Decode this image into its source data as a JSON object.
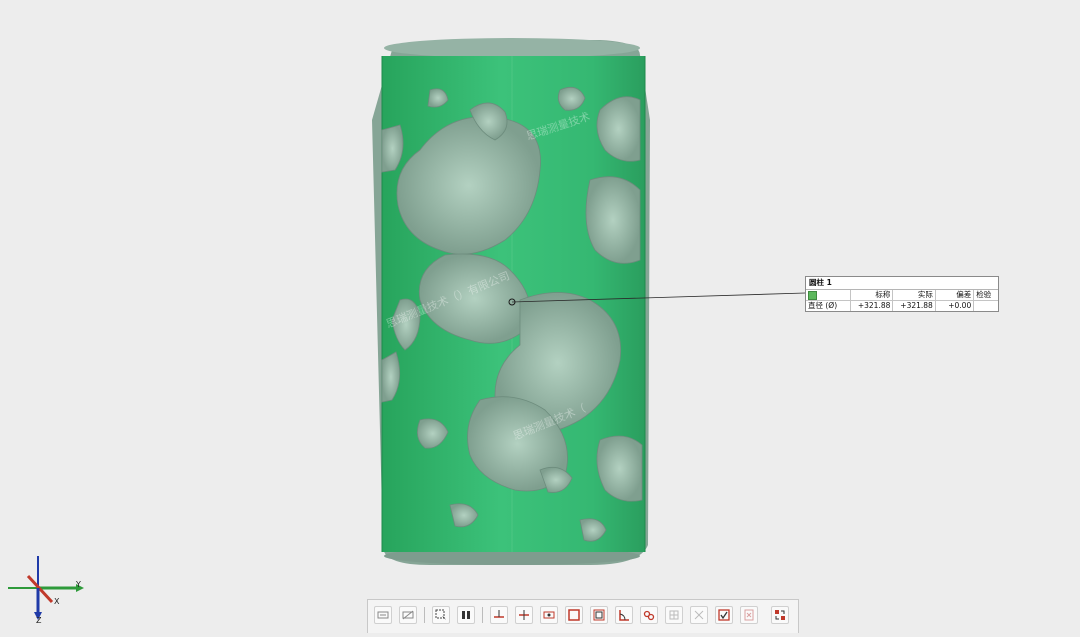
{
  "watermarks": [
    "思瑞测量技术",
    "思瑞测量技术（）有限公司",
    "思瑞测量技术（"
  ],
  "annotation": {
    "title": "圆柱 1",
    "headers": [
      "",
      "标称",
      "实际",
      "偏差",
      "检验"
    ],
    "row": {
      "label": "直径 (Ø)",
      "nominal": "+321.88",
      "actual": "+321.88",
      "deviation": "+0.00",
      "check": ""
    }
  },
  "axes": {
    "x": "X",
    "y": "Y",
    "z": "Z"
  },
  "toolbar_icons": [
    "label-icon",
    "hide-label-icon",
    "select-region-icon",
    "align-icon",
    "cut-plane-icon",
    "split-plane-icon",
    "section-view-icon",
    "frame-icon",
    "frame-inner-icon",
    "angle-icon",
    "link-icon",
    "grid-icon",
    "cross-icon",
    "check-box-icon",
    "delete-icon",
    "report-icon"
  ],
  "colors": {
    "background": "#ededed",
    "overlay_green": "#2fb26a",
    "model_gray": "#8aa89a",
    "axis_x": "#c0392b",
    "axis_y": "#2e9a3a",
    "axis_z": "#1f3aa8",
    "toolbar_accent": "#c0392b"
  }
}
